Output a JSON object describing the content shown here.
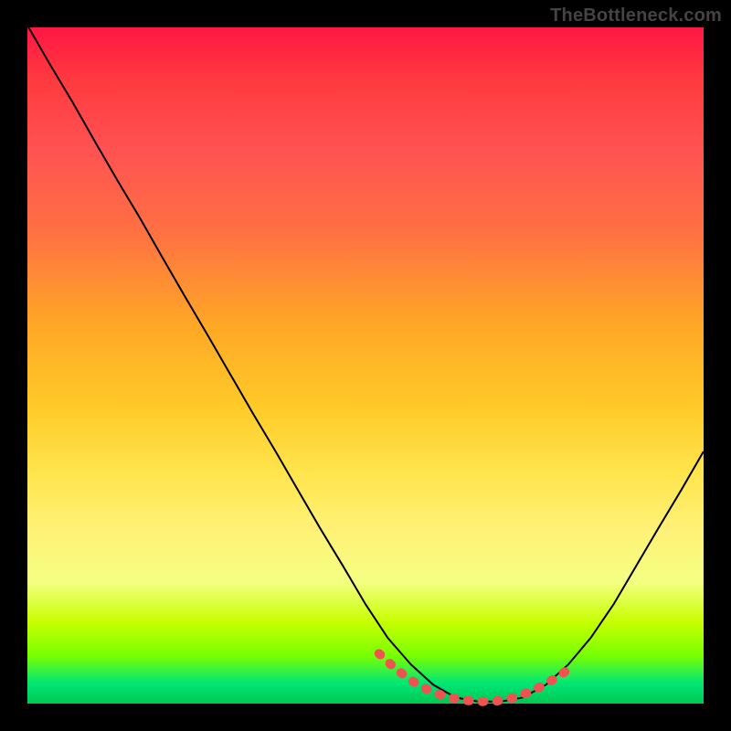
{
  "watermark": {
    "text": "TheBottleneck.com"
  },
  "chart_data": {
    "type": "line",
    "title": "",
    "xlabel": "",
    "ylabel": "",
    "xlim": [
      0,
      1
    ],
    "ylim": [
      0,
      1
    ],
    "grid": false,
    "legend": null,
    "annotations": [],
    "series": [
      {
        "name": "main-curve",
        "color": "#000000",
        "stroke_width": 2,
        "x": [
          0.0,
          0.033,
          0.067,
          0.1,
          0.133,
          0.167,
          0.2,
          0.233,
          0.267,
          0.3,
          0.333,
          0.367,
          0.4,
          0.433,
          0.467,
          0.5,
          0.533,
          0.567,
          0.6,
          0.633,
          0.667,
          0.7,
          0.733,
          0.767,
          0.8,
          0.833,
          0.867,
          0.9,
          0.933,
          0.967,
          1.0
        ],
        "y": [
          1.003,
          0.946,
          0.889,
          0.831,
          0.774,
          0.717,
          0.659,
          0.602,
          0.544,
          0.487,
          0.43,
          0.373,
          0.316,
          0.259,
          0.203,
          0.147,
          0.097,
          0.058,
          0.028,
          0.009,
          0.003,
          0.003,
          0.009,
          0.028,
          0.058,
          0.097,
          0.147,
          0.203,
          0.259,
          0.316,
          0.373
        ]
      },
      {
        "name": "valley-highlight",
        "color": "#ef5350",
        "stroke_width": 10,
        "dash": [
          2,
          14
        ],
        "linecap": "round",
        "x": [
          0.52,
          0.545,
          0.57,
          0.595,
          0.62,
          0.645,
          0.67,
          0.695,
          0.72,
          0.745,
          0.77,
          0.795
        ],
        "y": [
          0.074,
          0.051,
          0.033,
          0.019,
          0.01,
          0.005,
          0.003,
          0.004,
          0.009,
          0.018,
          0.031,
          0.047
        ]
      }
    ],
    "background_gradient_stops": [
      {
        "pos": 0.0,
        "color": "#ff1744"
      },
      {
        "pos": 0.18,
        "color": "#ff5252"
      },
      {
        "pos": 0.44,
        "color": "#ffa726"
      },
      {
        "pos": 0.66,
        "color": "#ffe54d"
      },
      {
        "pos": 0.88,
        "color": "#c6ff00"
      },
      {
        "pos": 1.0,
        "color": "#00c853"
      }
    ]
  }
}
